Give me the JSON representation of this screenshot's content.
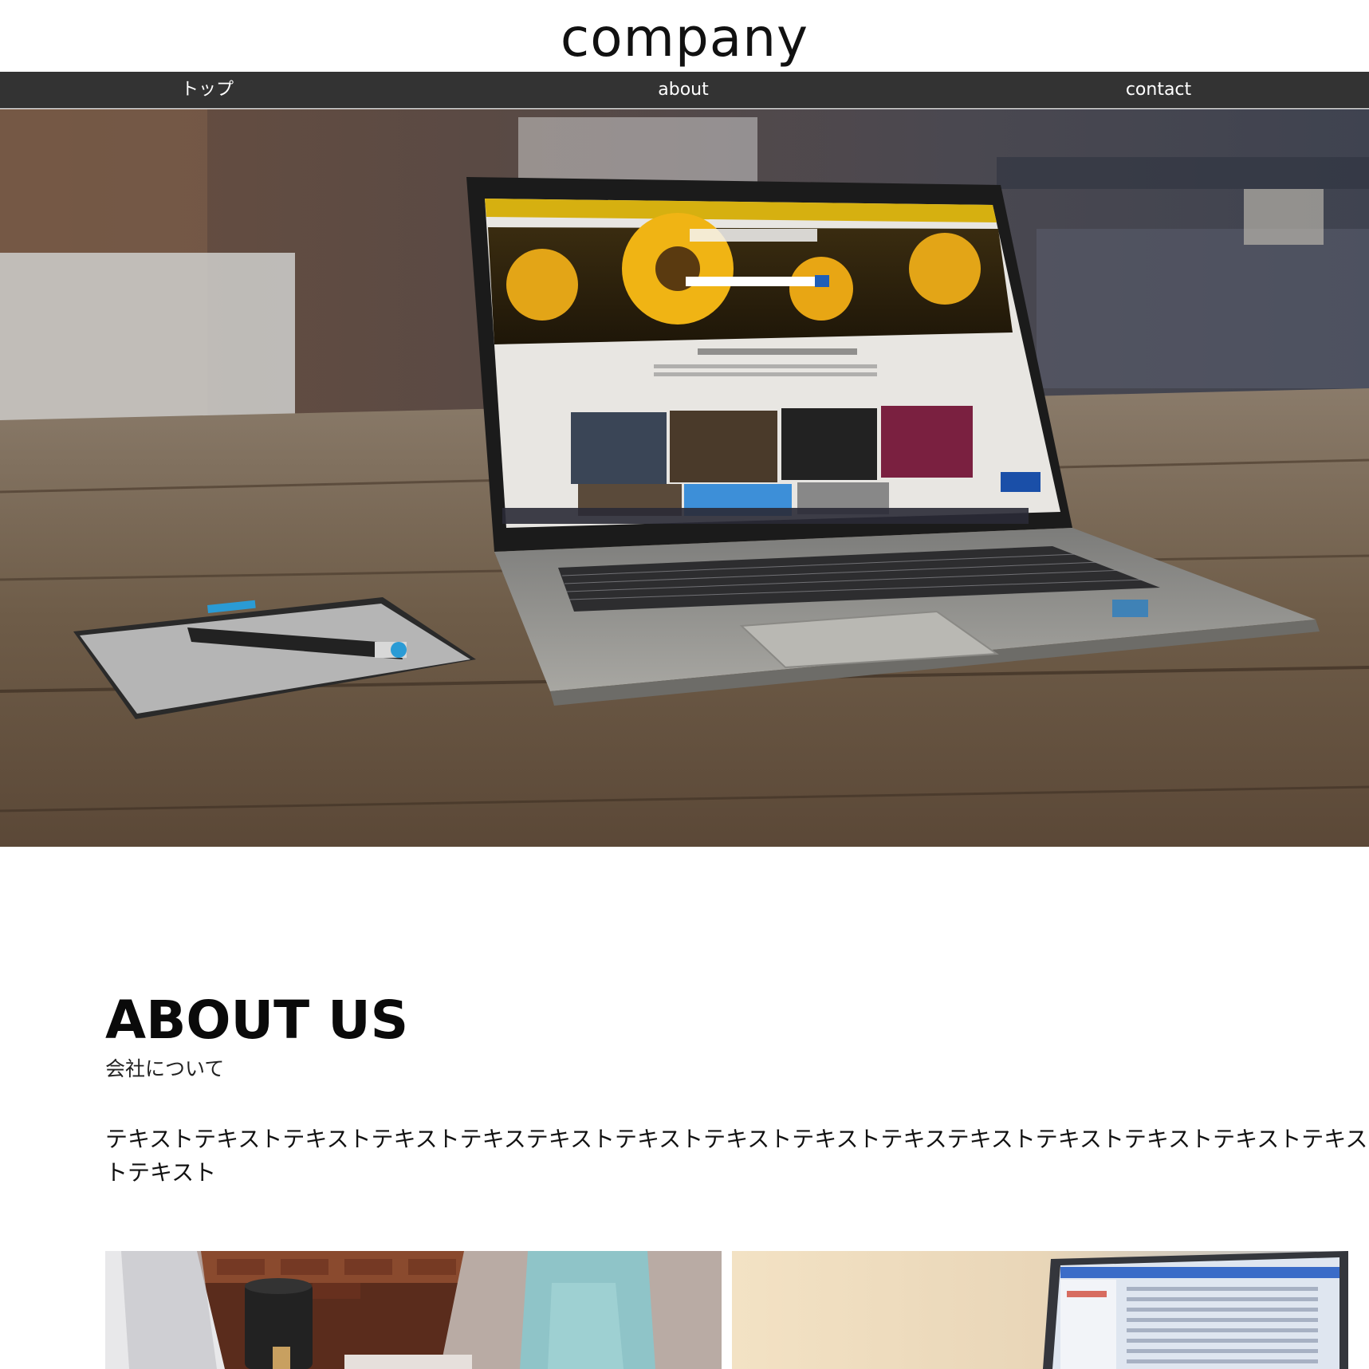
{
  "header": {
    "logo": "company"
  },
  "nav": {
    "items": [
      {
        "label": "トップ"
      },
      {
        "label": "about"
      },
      {
        "label": "contact"
      }
    ]
  },
  "about": {
    "title": "ABOUT US",
    "subtitle": "会社について",
    "text": "テキストテキストテキストテキストテキステキストテキストテキストテキストテキステキストテキストテキストテキストテキストテキスト"
  },
  "colors": {
    "nav_bg": "#333333",
    "text": "#111111"
  }
}
